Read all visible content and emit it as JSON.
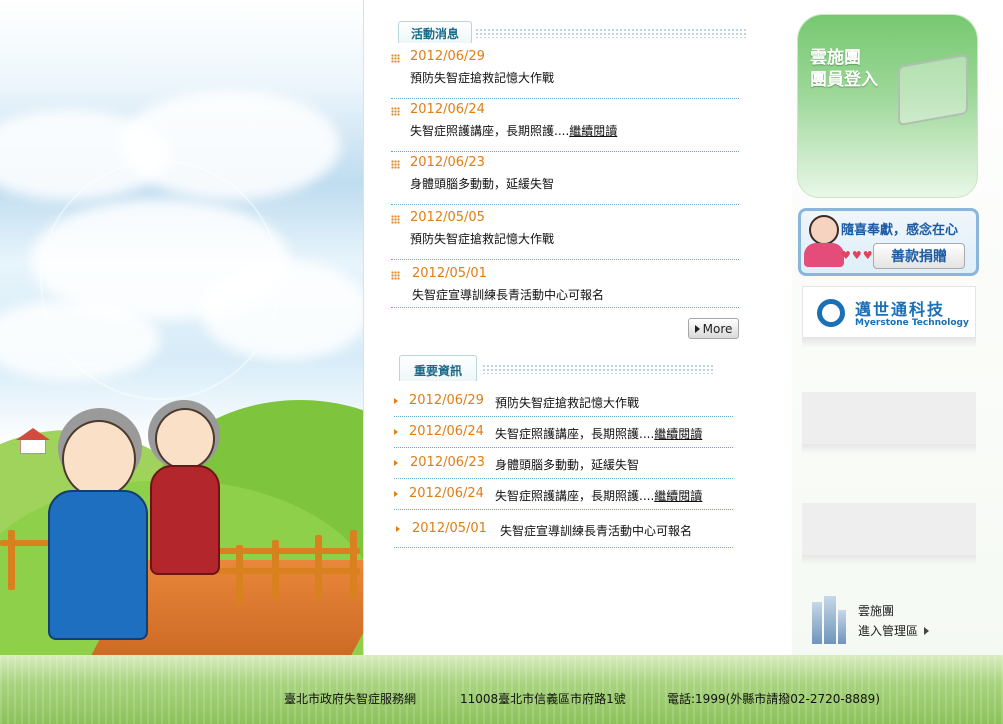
{
  "news": {
    "tab_label": "活動消息",
    "items": [
      {
        "date": "2012/06/29",
        "title": "預防失智症搶救記憶大作戰",
        "read_more": ""
      },
      {
        "date": "2012/06/24",
        "title": "失智症照護講座，長期照護....",
        "read_more": "繼續閱讀"
      },
      {
        "date": "2012/06/23",
        "title": "身體頭腦多動動，延緩失智",
        "read_more": ""
      },
      {
        "date": "2012/05/05",
        "title": "預防失智症搶救記憶大作戰",
        "read_more": ""
      },
      {
        "date": "2012/05/01",
        "title": "失智症宣導訓練長青活動中心可報名",
        "read_more": ""
      }
    ],
    "more_label": "More"
  },
  "info": {
    "tab_label": "重要資訊",
    "items": [
      {
        "date": "2012/06/29",
        "title": "預防失智症搶救記憶大作戰",
        "read_more": ""
      },
      {
        "date": "2012/06/24",
        "title": "失智症照護講座，長期照護....",
        "read_more": "繼續閱讀"
      },
      {
        "date": "2012/06/23",
        "title": "身體頭腦多動動，延緩失智",
        "read_more": ""
      },
      {
        "date": "2012/06/24",
        "title": "失智症照護講座，長期照護....",
        "read_more": "繼續閱讀"
      },
      {
        "date": "2012/05/01",
        "title": "失智症宣導訓練長青活動中心可報名",
        "read_more": ""
      }
    ]
  },
  "sidebar": {
    "login_line1": "雲施團",
    "login_line2": "團員登入",
    "donate_slogan": "隨喜奉獻，感念在心",
    "donate_button": "善款捐贈",
    "sponsor_name_zh": "邁世通科技",
    "sponsor_name_en": "Myerstone Technology",
    "admin_line1": "雲施團",
    "admin_line2": "進入管理區"
  },
  "footer": {
    "org": "臺北市政府失智症服務網",
    "address": "11008臺北市信義區市府路1號",
    "phone": "電話:1999(外縣市請撥02-2720-8889)"
  },
  "colors": {
    "date_orange": "#e07d14",
    "tab_teal": "#1a6a8a",
    "login_green": "#76c870",
    "brand_blue": "#1b6fb7"
  }
}
